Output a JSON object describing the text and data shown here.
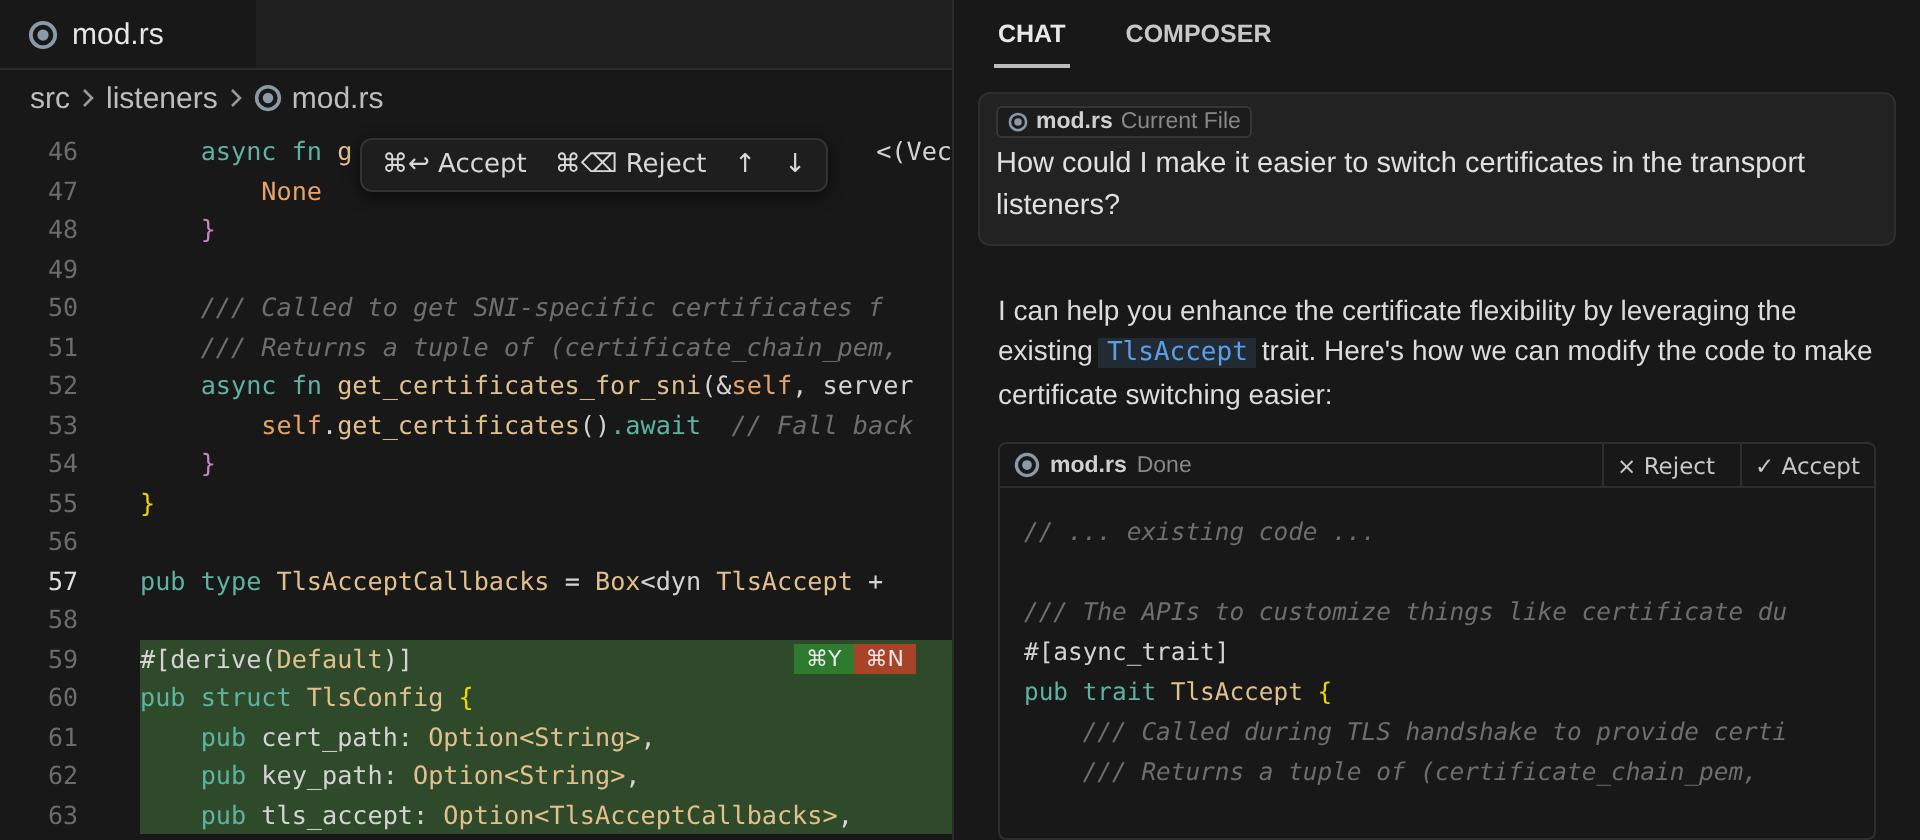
{
  "editor": {
    "tab": {
      "label": "mod.rs",
      "selected": true
    },
    "breadcrumb": [
      "src",
      "listeners",
      "mod.rs"
    ],
    "diff_popup": {
      "accept": "⌘↩ Accept",
      "reject": "⌘⌫ Reject",
      "up": "↑",
      "down": "↓"
    },
    "lines": [
      {
        "number": "46",
        "current": false,
        "added": false,
        "tokens": [
          {
            "text": "    async fn ",
            "kind": "kw"
          },
          {
            "text": "g",
            "kind": "fn"
          },
          {
            "text": "<(Vec",
            "kind": "tail"
          }
        ]
      },
      {
        "number": "47",
        "current": false,
        "added": false,
        "tokens": [
          {
            "text": "        None",
            "kind": "const"
          }
        ]
      },
      {
        "number": "48",
        "current": false,
        "added": false,
        "tokens": [
          {
            "text": "    }",
            "kind": "brace2"
          }
        ]
      },
      {
        "number": "49",
        "current": false,
        "added": false
      },
      {
        "number": "50",
        "current": false,
        "added": false,
        "tokens": [
          {
            "text": "    /// Called to get SNI-specific certificates f",
            "kind": "comment"
          }
        ]
      },
      {
        "number": "51",
        "current": false,
        "added": false,
        "tokens": [
          {
            "text": "    /// Returns a tuple of (certificate_chain_pem,",
            "kind": "comment"
          }
        ]
      },
      {
        "number": "52",
        "current": false,
        "added": false,
        "tokens": [
          {
            "text": "    async fn ",
            "kind": "kw"
          },
          {
            "text": "get_certificates_for_sni",
            "kind": "fn"
          },
          {
            "text": "(&",
            "kind": "plain"
          },
          {
            "text": "self",
            "kind": "const"
          },
          {
            "text": ", server",
            "kind": "plain"
          }
        ]
      },
      {
        "number": "53",
        "current": false,
        "added": false,
        "tokens": [
          {
            "text": "        self",
            "kind": "const"
          },
          {
            "text": ".",
            "kind": "plain"
          },
          {
            "text": "get_certificates",
            "kind": "fn"
          },
          {
            "text": "()",
            "kind": "plain"
          },
          {
            "text": ".await",
            "kind": "kw"
          },
          {
            "text": "  // Fall back",
            "kind": "comment"
          }
        ]
      },
      {
        "number": "54",
        "current": false,
        "added": false,
        "tokens": [
          {
            "text": "    }",
            "kind": "brace2"
          }
        ]
      },
      {
        "number": "55",
        "current": false,
        "added": false,
        "tokens": [
          {
            "text": "}",
            "kind": "brace1"
          }
        ]
      },
      {
        "number": "56",
        "current": false,
        "added": false
      },
      {
        "number": "57",
        "current": true,
        "added": false,
        "tokens": [
          {
            "text": "pub type ",
            "kind": "kw"
          },
          {
            "text": "TlsAcceptCallbacks",
            "kind": "fn"
          },
          {
            "text": " = ",
            "kind": "plain"
          },
          {
            "text": "Box",
            "kind": "fn"
          },
          {
            "text": "<dyn ",
            "kind": "plain"
          },
          {
            "text": "TlsAccept",
            "kind": "fn"
          },
          {
            "text": " + ",
            "kind": "plain"
          }
        ]
      },
      {
        "number": "58",
        "current": false,
        "added": false
      },
      {
        "number": "59",
        "current": false,
        "added": true,
        "tokens": [
          {
            "text": "#[derive(",
            "kind": "plain"
          },
          {
            "text": "Default",
            "kind": "fn"
          },
          {
            "text": ")]",
            "kind": "plain"
          }
        ]
      },
      {
        "number": "60",
        "current": false,
        "added": true,
        "tokens": [
          {
            "text": "pub struct ",
            "kind": "kw"
          },
          {
            "text": "TlsConfig",
            "kind": "fn"
          },
          {
            "text": " {",
            "kind": "brace1"
          }
        ]
      },
      {
        "number": "61",
        "current": false,
        "added": true,
        "tokens": [
          {
            "text": "    pub ",
            "kind": "kw"
          },
          {
            "text": "cert_path: ",
            "kind": "plain"
          },
          {
            "text": "Option<String>",
            "kind": "fn"
          },
          {
            "text": ",",
            "kind": "plain"
          }
        ]
      },
      {
        "number": "62",
        "current": false,
        "added": true,
        "tokens": [
          {
            "text": "    pub ",
            "kind": "kw"
          },
          {
            "text": "key_path: ",
            "kind": "plain"
          },
          {
            "text": "Option<String>",
            "kind": "fn"
          },
          {
            "text": ",",
            "kind": "plain"
          }
        ]
      },
      {
        "number": "63",
        "current": false,
        "added": true,
        "tokens": [
          {
            "text": "    pub ",
            "kind": "kw"
          },
          {
            "text": "tls_accept: ",
            "kind": "plain"
          },
          {
            "text": "Option<TlsAcceptCallbacks>",
            "kind": "fn"
          },
          {
            "text": ",",
            "kind": "plain"
          }
        ]
      }
    ],
    "hunk_keys": {
      "accept": "⌘Y",
      "reject": "⌘N"
    }
  },
  "chat": {
    "tabs": [
      {
        "label": "CHAT",
        "selected": true
      },
      {
        "label": "COMPOSER",
        "selected": false
      }
    ],
    "user_message": {
      "file": "mod.rs",
      "file_note": "Current File",
      "text": "How could I make it easier to switch certificates in the transport listeners?"
    },
    "response": {
      "before": "I can help you enhance the certificate flexibility by leveraging the existing",
      "code": "TlsAccept",
      "after": "trait. Here's how we can modify the code to make certificate switching easier:"
    },
    "code_block": {
      "file": "mod.rs",
      "status": "Done",
      "reject": "× Reject",
      "accept": "✓ Accept",
      "lines": [
        {
          "tokens": [
            {
              "text": "// ... existing code ...",
              "kind": "comment"
            }
          ]
        },
        {
          "blank": true
        },
        {
          "tokens": [
            {
              "text": "/// The APIs to customize things like certificate du",
              "kind": "comment"
            }
          ]
        },
        {
          "tokens": [
            {
              "text": "#[async_trait]",
              "kind": "plain"
            }
          ]
        },
        {
          "tokens": [
            {
              "text": "pub trait ",
              "kind": "kw"
            },
            {
              "text": "TlsAccept",
              "kind": "fn"
            },
            {
              "text": " {",
              "kind": "brace1"
            }
          ]
        },
        {
          "tokens": [
            {
              "text": "    /// Called during TLS handshake to provide certi",
              "kind": "comment"
            }
          ]
        },
        {
          "tokens": [
            {
              "text": "    /// Returns a tuple of (certificate_chain_pem,",
              "kind": "comment"
            }
          ]
        }
      ]
    }
  }
}
